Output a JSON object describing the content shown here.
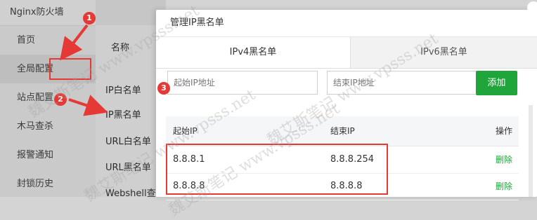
{
  "app": {
    "title": "Nginx防火墙"
  },
  "sidebar": {
    "items": [
      {
        "label": "首页"
      },
      {
        "label": "全局配置"
      },
      {
        "label": "站点配置"
      },
      {
        "label": "木马查杀"
      },
      {
        "label": "报警通知"
      },
      {
        "label": "封锁历史"
      }
    ]
  },
  "background_table": {
    "column_header": "名称",
    "rows": [
      "IP白名单",
      "IP黑名单",
      "URL白名单",
      "URL黑名单",
      "Webshell查"
    ]
  },
  "modal": {
    "title": "管理IP黑名单",
    "tabs": [
      {
        "label": "IPv4黑名单"
      },
      {
        "label": "IPv6黑名单"
      }
    ],
    "start_ip_placeholder": "起始IP地址",
    "end_ip_placeholder": "结束IP地址",
    "add_button": "添加",
    "table": {
      "headers": {
        "start": "起始IP",
        "end": "结束IP",
        "action": "操作"
      },
      "rows": [
        {
          "start": "8.8.8.1",
          "end": "8.8.8.254",
          "action": "删除"
        },
        {
          "start": "8.8.8.8",
          "end": "8.8.8.8",
          "action": "删除"
        }
      ]
    }
  },
  "annotations": {
    "badge1": "1",
    "badge2": "2",
    "badge3": "3",
    "color": "#e53935"
  },
  "watermark": {
    "text": "魏艾斯笔记 www.vpsss.net"
  },
  "colors": {
    "accent": "#20a53a",
    "annotation": "#e53935"
  }
}
